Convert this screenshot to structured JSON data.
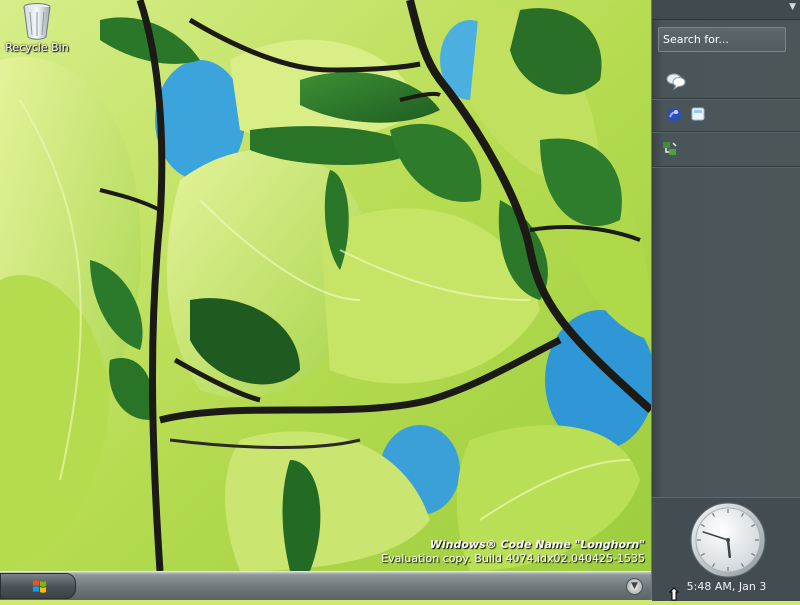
{
  "desktop": {
    "icons": [
      {
        "label": "Recycle Bin",
        "icon": "recycle-bin-icon"
      }
    ],
    "watermark": {
      "title": "Windows® Code Name \"Longhorn\"",
      "build": "Evaluation copy. Build 4074.idx02.040425-1535"
    }
  },
  "sidebar": {
    "search_placeholder": "Search for...",
    "tiles": [
      {
        "icon": "chat-bubbles-icon"
      },
      {
        "icon": "contacts-icon"
      },
      {
        "icon": "notepad-icon"
      },
      {
        "icon": "network-icon"
      }
    ],
    "clock": {
      "time_text": "5:48 AM, Jan 3",
      "hour": 5,
      "minute": 48
    }
  },
  "taskbar": {
    "start_icon": "windows-flag-icon",
    "overflow_icon": "chevron-down-icon"
  },
  "colors": {
    "sidebar_bg": "#4b5659",
    "taskbar": "#727a7e",
    "leaf_light": "#c8e45a",
    "leaf_dark": "#2f7a2a",
    "sky": "#3aa2dc"
  }
}
